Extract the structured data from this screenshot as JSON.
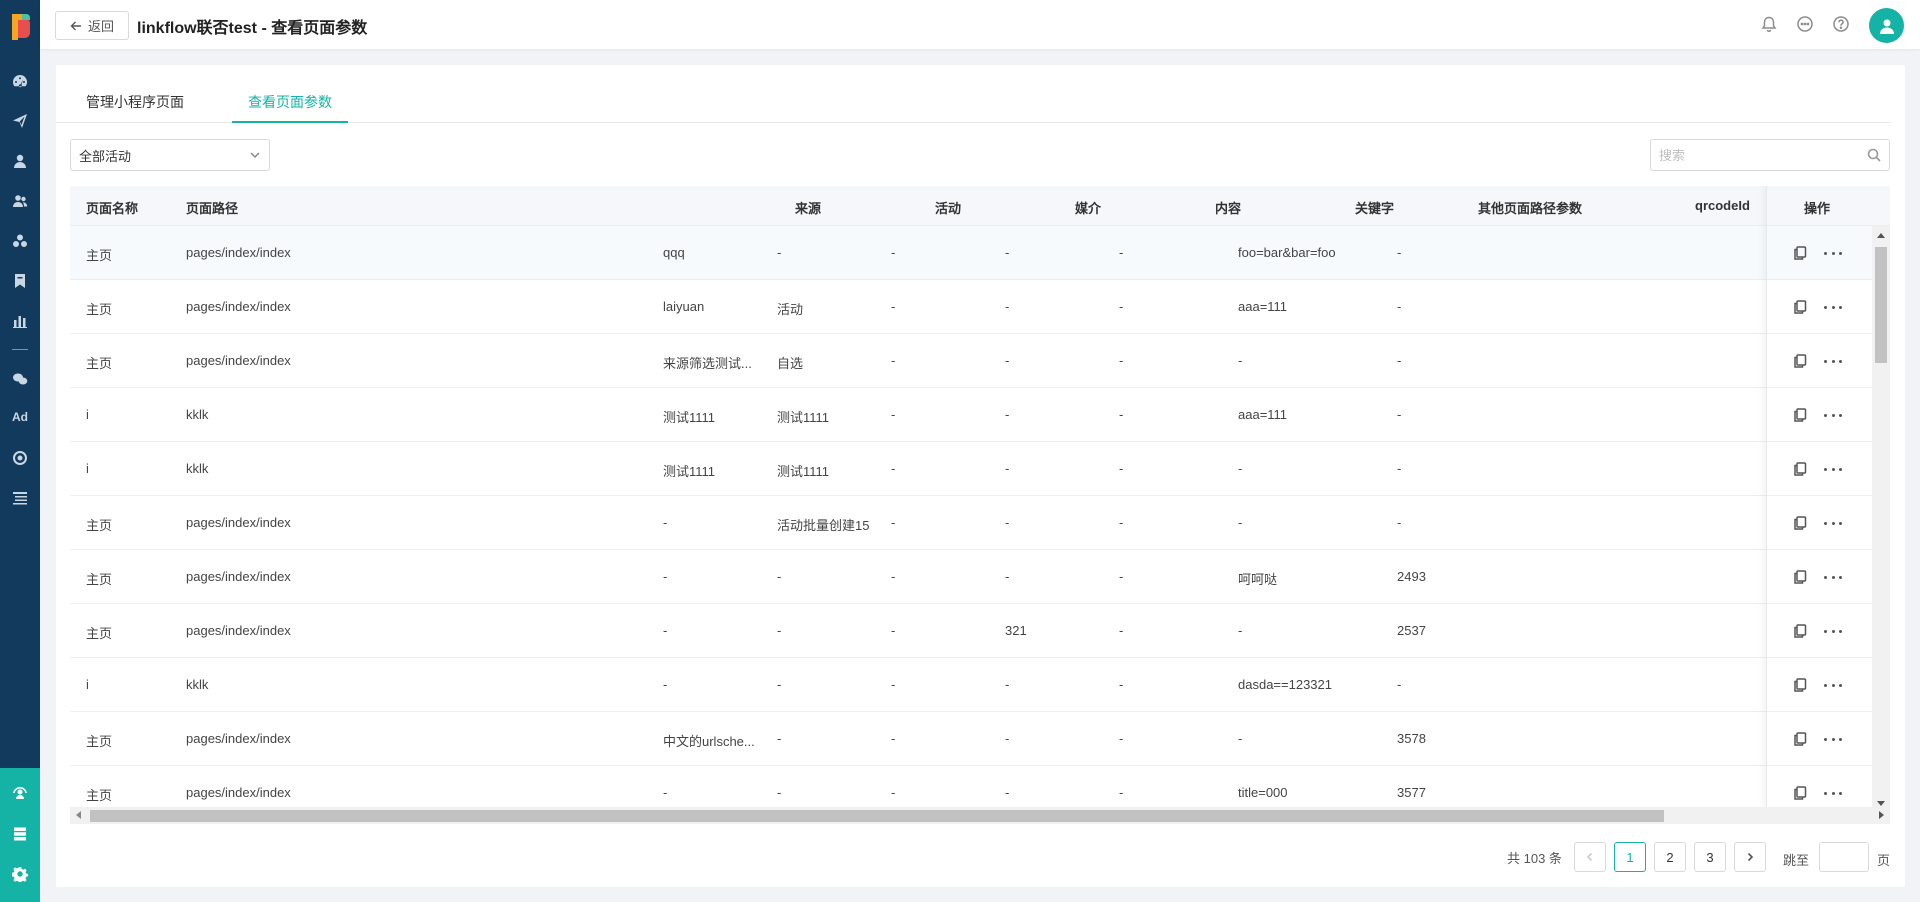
{
  "header": {
    "back_label": "返回",
    "title": "linkflow联否test - 查看页面参数"
  },
  "tabs": [
    {
      "label": "管理小程序页面",
      "active": false
    },
    {
      "label": "查看页面参数",
      "active": true
    }
  ],
  "filter": {
    "activity_select_value": "全部活动",
    "search_placeholder": "搜索",
    "search_value": ""
  },
  "table": {
    "columns": [
      "页面名称",
      "页面路径",
      "来源",
      "活动",
      "媒介",
      "内容",
      "关键字",
      "其他页面路径参数",
      "qrcodeId",
      "操作"
    ],
    "rows": [
      {
        "name": "主页",
        "path": "pages/index/index",
        "source": "qqq",
        "activity": "-",
        "medium": "-",
        "content": "-",
        "keyword": "-",
        "params": "foo=bar&bar=foo",
        "qrcode": "-"
      },
      {
        "name": "主页",
        "path": "pages/index/index",
        "source": "laiyuan",
        "activity": "活动",
        "medium": "-",
        "content": "-",
        "keyword": "-",
        "params": "aaa=111",
        "qrcode": "-"
      },
      {
        "name": "主页",
        "path": "pages/index/index",
        "source": "来源筛选测试...",
        "activity": "自选",
        "medium": "-",
        "content": "-",
        "keyword": "-",
        "params": "-",
        "qrcode": "-"
      },
      {
        "name": "i",
        "path": "kklk",
        "source": "测试1111",
        "activity": "测试1111",
        "medium": "-",
        "content": "-",
        "keyword": "-",
        "params": "aaa=111",
        "qrcode": "-"
      },
      {
        "name": "i",
        "path": "kklk",
        "source": "测试1111",
        "activity": "测试1111",
        "medium": "-",
        "content": "-",
        "keyword": "-",
        "params": "-",
        "qrcode": "-"
      },
      {
        "name": "主页",
        "path": "pages/index/index",
        "source": "-",
        "activity": "活动批量创建15",
        "medium": "-",
        "content": "-",
        "keyword": "-",
        "params": "-",
        "qrcode": "-"
      },
      {
        "name": "主页",
        "path": "pages/index/index",
        "source": "-",
        "activity": "-",
        "medium": "-",
        "content": "-",
        "keyword": "-",
        "params": "呵呵哒",
        "qrcode": "2493"
      },
      {
        "name": "主页",
        "path": "pages/index/index",
        "source": "-",
        "activity": "-",
        "medium": "-",
        "content": "321",
        "keyword": "-",
        "params": "-",
        "qrcode": "2537"
      },
      {
        "name": "i",
        "path": "kklk",
        "source": "-",
        "activity": "-",
        "medium": "-",
        "content": "-",
        "keyword": "-",
        "params": "dasda==123321",
        "qrcode": "-"
      },
      {
        "name": "主页",
        "path": "pages/index/index",
        "source": "中文的urlsche...",
        "activity": "-",
        "medium": "-",
        "content": "-",
        "keyword": "-",
        "params": "-",
        "qrcode": "3578"
      },
      {
        "name": "主页",
        "path": "pages/index/index",
        "source": "-",
        "activity": "-",
        "medium": "-",
        "content": "-",
        "keyword": "-",
        "params": "title=000",
        "qrcode": "3577"
      }
    ]
  },
  "pagination": {
    "total_text": "共 103 条",
    "pages": [
      "1",
      "2",
      "3"
    ],
    "current_page": "1",
    "jump_label": "跳至",
    "page_unit": "页",
    "jump_value": ""
  },
  "sidebar": {
    "ad_label": "Ad"
  },
  "colors": {
    "accent": "#14b3a5",
    "sidebar": "#123a5c"
  }
}
